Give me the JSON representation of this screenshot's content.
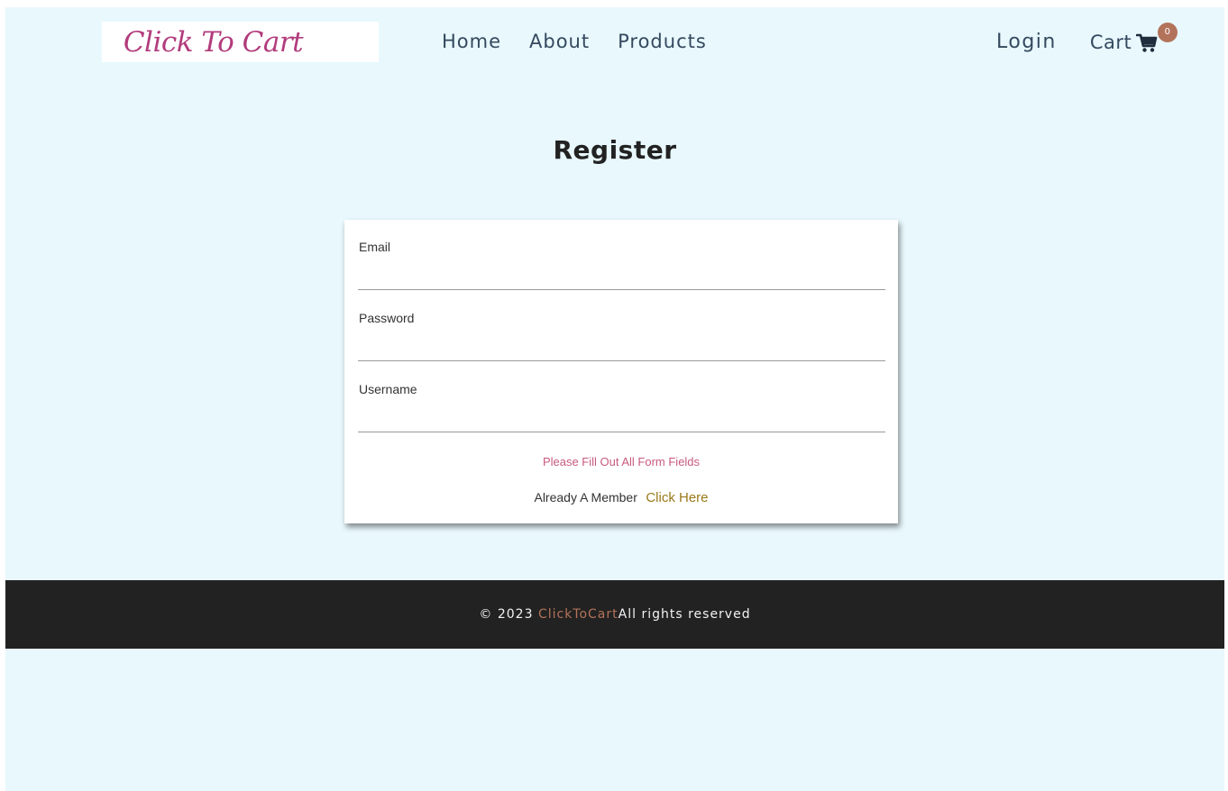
{
  "navbar": {
    "logo_text": "Click To Cart",
    "links": {
      "home": "Home",
      "about": "About",
      "products": "Products"
    },
    "login_label": "Login",
    "cart_label": "Cart",
    "cart_count": "0"
  },
  "main": {
    "title": "Register",
    "form": {
      "email_label": "Email",
      "email_value": "",
      "password_label": "Password",
      "password_value": "",
      "username_label": "Username",
      "username_value": "",
      "error_message": "Please Fill Out All Form Fields",
      "member_text": "Already A Member",
      "member_link": "Click Here"
    }
  },
  "footer": {
    "prefix": "© 2023",
    "brand": "ClickToCart",
    "suffix": "All rights reserved"
  },
  "colors": {
    "page_background": "#e8f8fd",
    "logo": "#b23c7d",
    "nav_text": "#34495e",
    "badge": "#b3735b",
    "error": "#c85a7d",
    "link": "#9a7a1a",
    "footer_background": "#222222",
    "footer_brand": "#b3735b"
  },
  "icons": {
    "cart": "shopping-cart-icon"
  }
}
